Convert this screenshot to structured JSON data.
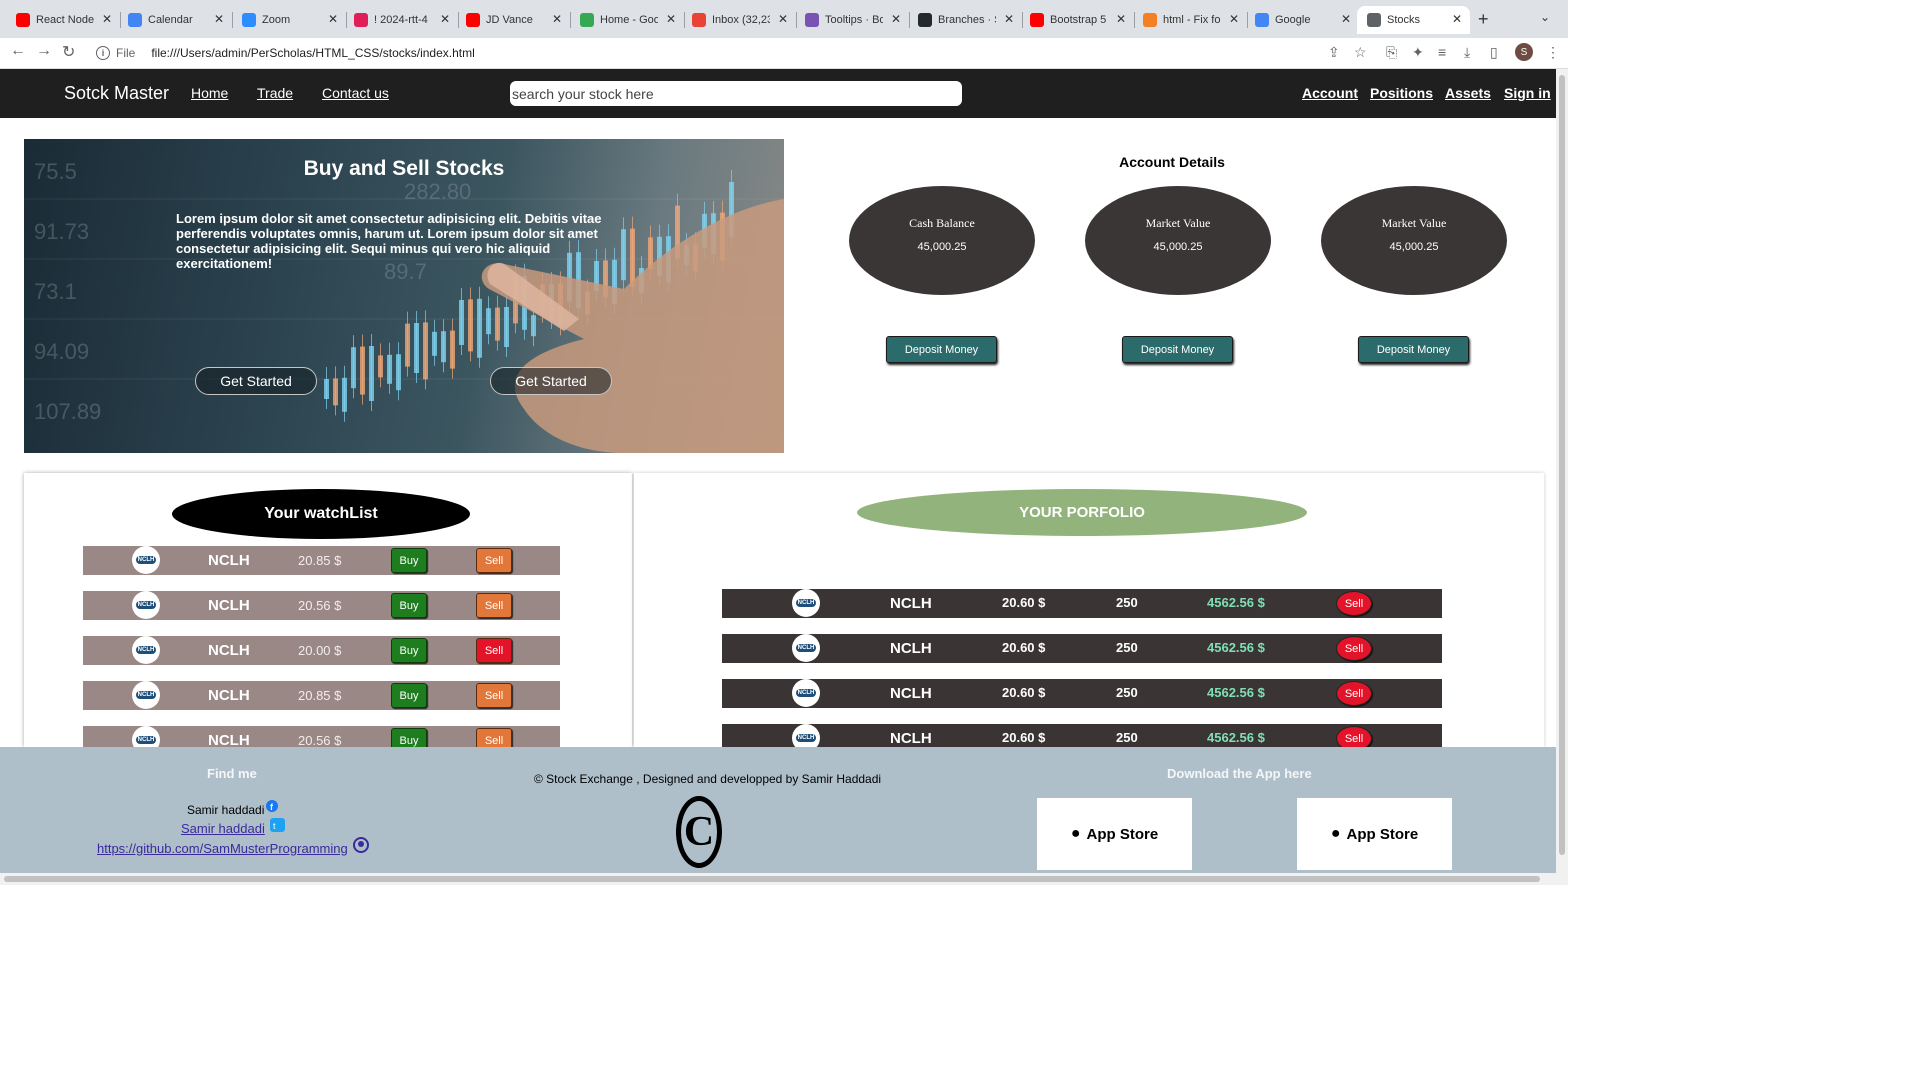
{
  "browser": {
    "tabs": [
      {
        "label": "React Node.js",
        "icon": "youtube-icon",
        "color": "#ff0000"
      },
      {
        "label": "Calendar",
        "icon": "calendar-icon",
        "color": "#4285f4"
      },
      {
        "label": "Zoom",
        "icon": "zoom-icon",
        "color": "#2d8cff"
      },
      {
        "label": "! 2024-rtt-4",
        "icon": "slack-icon",
        "color": "#e01e5a"
      },
      {
        "label": "JD Vance",
        "icon": "youtube-icon",
        "color": "#ff0000"
      },
      {
        "label": "Home - Goo",
        "icon": "drive-icon",
        "color": "#34a853"
      },
      {
        "label": "Inbox (32,23",
        "icon": "gmail-icon",
        "color": "#ea4335"
      },
      {
        "label": "Tooltips · Bo",
        "icon": "bootstrap-icon",
        "color": "#7952b3"
      },
      {
        "label": "Branches · S",
        "icon": "github-icon",
        "color": "#24292e"
      },
      {
        "label": "Bootstrap 5",
        "icon": "youtube-icon",
        "color": "#ff0000"
      },
      {
        "label": "html - Fix fo",
        "icon": "stackoverflow-icon",
        "color": "#f48024"
      },
      {
        "label": "Google",
        "icon": "google-icon",
        "color": "#4285f4"
      },
      {
        "label": "Stocks",
        "icon": "globe-icon",
        "color": "#5f6368"
      }
    ],
    "url_scheme": "File",
    "url": "file:///Users/admin/PerScholas/HTML_CSS/stocks/index.html",
    "profile_initial": "S"
  },
  "nav": {
    "brand": "Sotck Master",
    "links": [
      "Home",
      "Trade",
      "Contact us"
    ],
    "search_placeholder": "search your stock here",
    "right_links": [
      "Account",
      "Positions",
      "Assets",
      "Sign in"
    ]
  },
  "hero": {
    "title": "Buy and Sell Stocks",
    "text": "Lorem ipsum dolor sit amet consectetur adipisicing elit. Debitis vitae perferendis voluptates omnis, harum ut. Lorem ipsum dolor sit amet consectetur adipisicing elit. Sequi minus qui vero hic aliquid exercitationem!",
    "buttons": [
      "Get Started",
      "Get Started"
    ]
  },
  "account": {
    "title": "Account Details",
    "cards": [
      {
        "label": "Cash Balance",
        "value": "45,000.25",
        "button": "Deposit Money"
      },
      {
        "label": "Market Value",
        "value": "45,000.25",
        "button": "Deposit Money"
      },
      {
        "label": "Market Value",
        "value": "45,000.25",
        "button": "Deposit Money"
      }
    ]
  },
  "watchlist": {
    "title": "Your watchList",
    "logo_text": "NCLH",
    "buy_label": "Buy",
    "sell_label": "Sell",
    "rows": [
      {
        "symbol": "NCLH",
        "price": "20.85 $",
        "sell_color": "#e2773a"
      },
      {
        "symbol": "NCLH",
        "price": "20.56 $",
        "sell_color": "#e2773a"
      },
      {
        "symbol": "NCLH",
        "price": "20.00 $",
        "sell_color": "#e3142a"
      },
      {
        "symbol": "NCLH",
        "price": "20.85 $",
        "sell_color": "#e2773a"
      },
      {
        "symbol": "NCLH",
        "price": "20.56 $",
        "sell_color": "#e2773a"
      }
    ]
  },
  "portfolio": {
    "title": "YOUR PORFOLIO",
    "logo_text": "NCLH",
    "sell_label": "Sell",
    "rows": [
      {
        "symbol": "NCLH",
        "price": "20.60 $",
        "qty": "250",
        "total": "4562.56 $"
      },
      {
        "symbol": "NCLH",
        "price": "20.60 $",
        "qty": "250",
        "total": "4562.56 $"
      },
      {
        "symbol": "NCLH",
        "price": "20.60 $",
        "qty": "250",
        "total": "4562.56 $"
      },
      {
        "symbol": "NCLH",
        "price": "20.60 $",
        "qty": "250",
        "total": "4562.56 $"
      }
    ]
  },
  "footer": {
    "find_me": "Find me",
    "name_text": "Samir haddadi",
    "name_link": "Samir haddadi",
    "github_link": "https://github.com/SamMusterProgramming",
    "copyright": "© Stock Exchange , Designed and developped by Samir Haddadi",
    "copyright_symbol": "C",
    "download_title": "Download the App here",
    "app_store": [
      "App Store",
      "App Store"
    ]
  },
  "colors": {
    "nav_bg": "#1f1f1f",
    "deposit": "#2c6b6b",
    "buy": "#1e7d1e",
    "portfolio_title": "#93b37d",
    "gain": "#7fe0b5",
    "footer_bg": "#aebfca"
  }
}
